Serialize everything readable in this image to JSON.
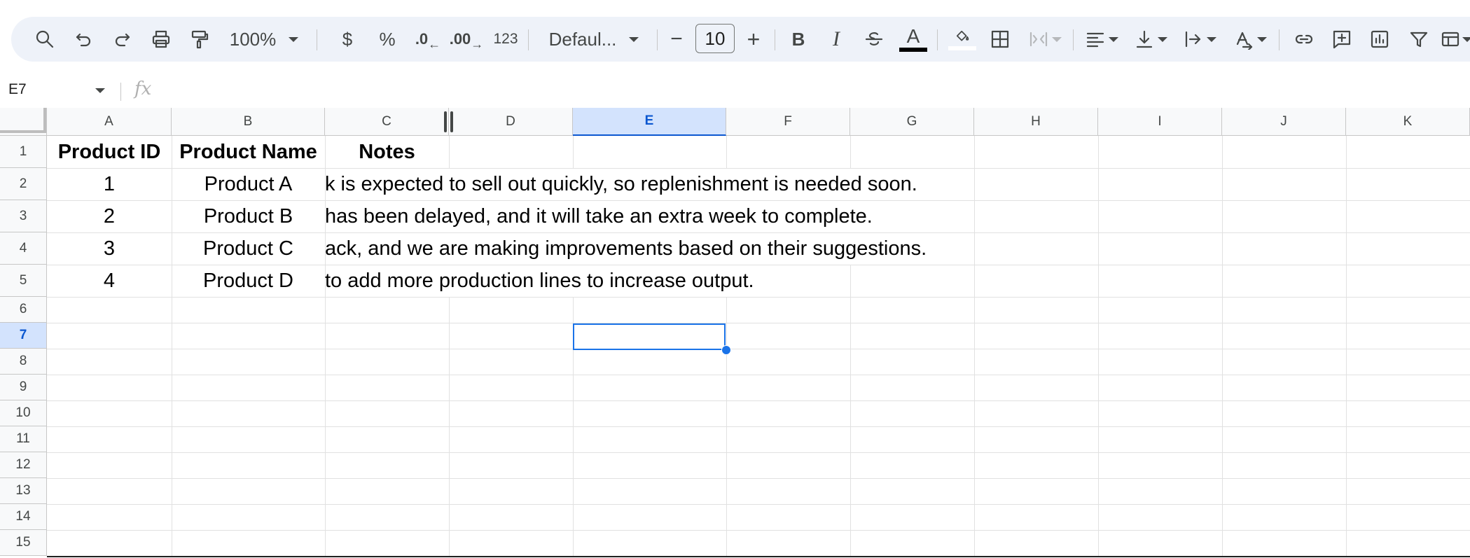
{
  "toolbar": {
    "zoom": "100%",
    "currency": "$",
    "percent": "%",
    "decrease_decimal": ".0",
    "increase_decimal": ".00",
    "number_format": "123",
    "font": "Defaul...",
    "font_size": "10",
    "minus": "−",
    "plus": "+",
    "bold": "B",
    "italic": "I",
    "text_color_letter": "A"
  },
  "formula_bar": {
    "name_box": "E7",
    "fx": "fx",
    "value": ""
  },
  "columns": [
    "A",
    "B",
    "C",
    "D",
    "E",
    "F",
    "G",
    "H",
    "I",
    "J",
    "K"
  ],
  "selected_column": "E",
  "rows": [
    "1",
    "2",
    "3",
    "4",
    "5",
    "6",
    "7",
    "8",
    "9",
    "10",
    "11",
    "12",
    "13",
    "14",
    "15"
  ],
  "selected_row": "7",
  "headers": {
    "product_id": "Product ID",
    "product_name": "Product Name",
    "notes": "Notes"
  },
  "data": [
    {
      "id": "1",
      "name": "Product A",
      "note": "k is expected to sell out quickly, so replenishment is needed soon."
    },
    {
      "id": "2",
      "name": "Product B",
      "note": "has been delayed, and it will take an extra week to complete."
    },
    {
      "id": "3",
      "name": "Product C",
      "note": "ack, and we are making improvements based on their suggestions."
    },
    {
      "id": "4",
      "name": "Product D",
      "note": "to add more production lines to increase output."
    }
  ],
  "colors": {
    "toolbar_bg": "#eef2f9",
    "selection": "#1a73e8",
    "header_selected_bg": "#d3e3fd"
  }
}
